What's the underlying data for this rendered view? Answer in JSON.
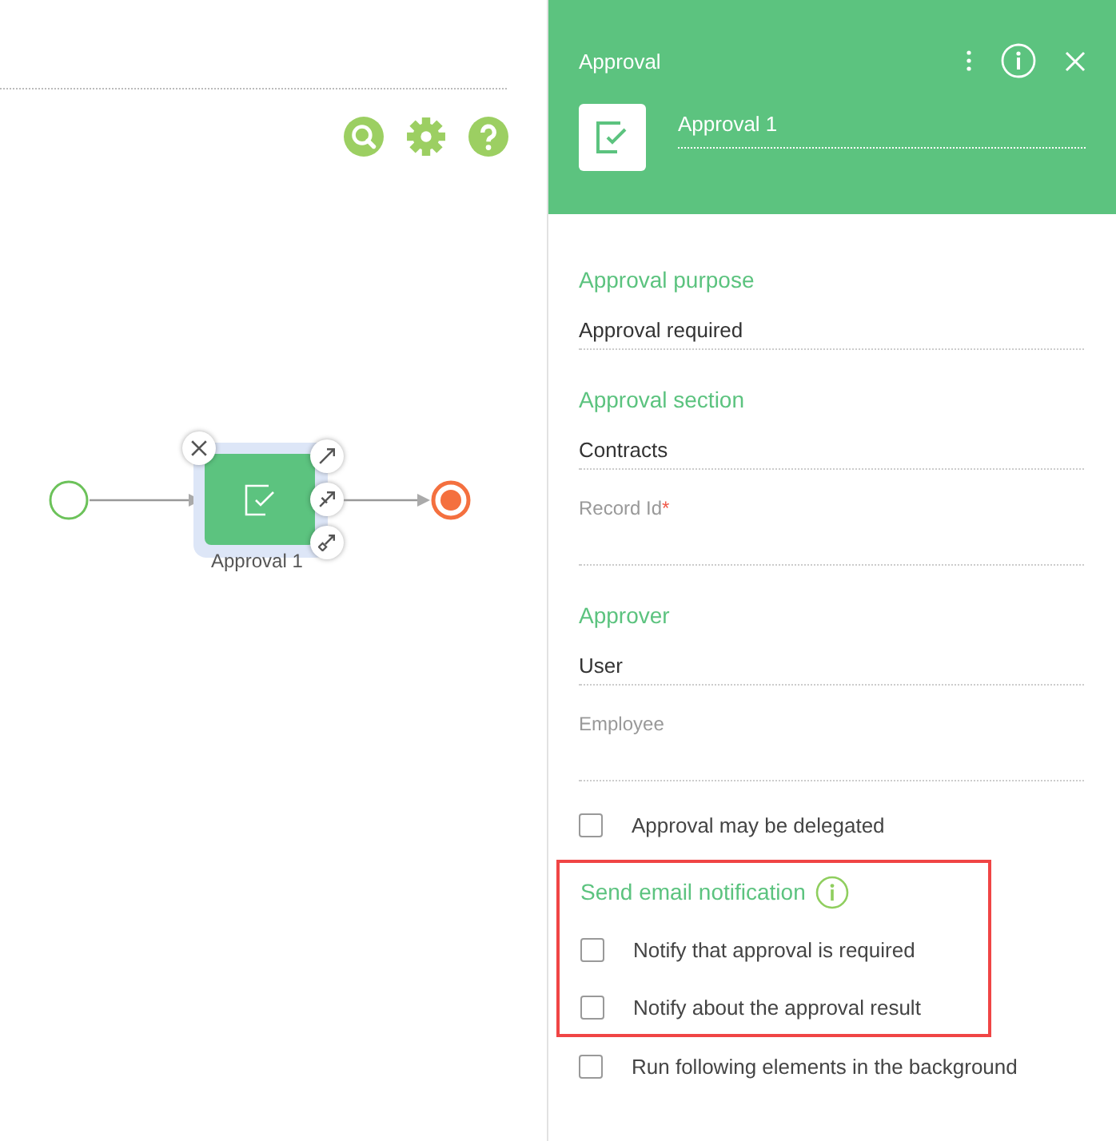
{
  "diagram": {
    "task_label": "Approval 1"
  },
  "panel": {
    "title": "Approval",
    "element_name": "Approval 1",
    "items": [
      {
        "kind": "heading",
        "text": "Approval purpose"
      },
      {
        "kind": "value",
        "value": "Approval required"
      },
      {
        "kind": "heading",
        "text": "Approval section"
      },
      {
        "kind": "value",
        "value": "Contracts"
      },
      {
        "kind": "input",
        "label": "Record Id",
        "required_mark": "*"
      },
      {
        "kind": "heading",
        "text": "Approver"
      },
      {
        "kind": "value",
        "value": "User"
      },
      {
        "kind": "input",
        "label": "Employee"
      },
      {
        "kind": "checkbox",
        "label": "Approval may be delegated",
        "checked": false
      },
      {
        "kind": "group",
        "highlighted": true,
        "heading": "Send email notification",
        "checkboxes": [
          {
            "label": "Notify that approval is required",
            "checked": false
          },
          {
            "label": "Notify about the approval result",
            "checked": false
          }
        ]
      },
      {
        "kind": "checkbox",
        "label": "Run following elements in the background",
        "checked": false
      }
    ]
  }
}
